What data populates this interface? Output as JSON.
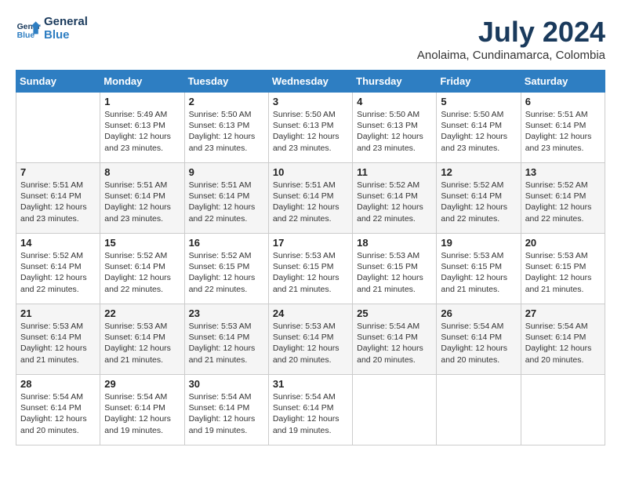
{
  "logo": {
    "line1": "General",
    "line2": "Blue"
  },
  "title": "July 2024",
  "location": "Anolaima, Cundinamarca, Colombia",
  "days_header": [
    "Sunday",
    "Monday",
    "Tuesday",
    "Wednesday",
    "Thursday",
    "Friday",
    "Saturday"
  ],
  "weeks": [
    [
      {
        "day": "",
        "info": ""
      },
      {
        "day": "1",
        "info": "Sunrise: 5:49 AM\nSunset: 6:13 PM\nDaylight: 12 hours\nand 23 minutes."
      },
      {
        "day": "2",
        "info": "Sunrise: 5:50 AM\nSunset: 6:13 PM\nDaylight: 12 hours\nand 23 minutes."
      },
      {
        "day": "3",
        "info": "Sunrise: 5:50 AM\nSunset: 6:13 PM\nDaylight: 12 hours\nand 23 minutes."
      },
      {
        "day": "4",
        "info": "Sunrise: 5:50 AM\nSunset: 6:13 PM\nDaylight: 12 hours\nand 23 minutes."
      },
      {
        "day": "5",
        "info": "Sunrise: 5:50 AM\nSunset: 6:14 PM\nDaylight: 12 hours\nand 23 minutes."
      },
      {
        "day": "6",
        "info": "Sunrise: 5:51 AM\nSunset: 6:14 PM\nDaylight: 12 hours\nand 23 minutes."
      }
    ],
    [
      {
        "day": "7",
        "info": "Sunrise: 5:51 AM\nSunset: 6:14 PM\nDaylight: 12 hours\nand 23 minutes."
      },
      {
        "day": "8",
        "info": "Sunrise: 5:51 AM\nSunset: 6:14 PM\nDaylight: 12 hours\nand 23 minutes."
      },
      {
        "day": "9",
        "info": "Sunrise: 5:51 AM\nSunset: 6:14 PM\nDaylight: 12 hours\nand 22 minutes."
      },
      {
        "day": "10",
        "info": "Sunrise: 5:51 AM\nSunset: 6:14 PM\nDaylight: 12 hours\nand 22 minutes."
      },
      {
        "day": "11",
        "info": "Sunrise: 5:52 AM\nSunset: 6:14 PM\nDaylight: 12 hours\nand 22 minutes."
      },
      {
        "day": "12",
        "info": "Sunrise: 5:52 AM\nSunset: 6:14 PM\nDaylight: 12 hours\nand 22 minutes."
      },
      {
        "day": "13",
        "info": "Sunrise: 5:52 AM\nSunset: 6:14 PM\nDaylight: 12 hours\nand 22 minutes."
      }
    ],
    [
      {
        "day": "14",
        "info": "Sunrise: 5:52 AM\nSunset: 6:14 PM\nDaylight: 12 hours\nand 22 minutes."
      },
      {
        "day": "15",
        "info": "Sunrise: 5:52 AM\nSunset: 6:14 PM\nDaylight: 12 hours\nand 22 minutes."
      },
      {
        "day": "16",
        "info": "Sunrise: 5:52 AM\nSunset: 6:15 PM\nDaylight: 12 hours\nand 22 minutes."
      },
      {
        "day": "17",
        "info": "Sunrise: 5:53 AM\nSunset: 6:15 PM\nDaylight: 12 hours\nand 21 minutes."
      },
      {
        "day": "18",
        "info": "Sunrise: 5:53 AM\nSunset: 6:15 PM\nDaylight: 12 hours\nand 21 minutes."
      },
      {
        "day": "19",
        "info": "Sunrise: 5:53 AM\nSunset: 6:15 PM\nDaylight: 12 hours\nand 21 minutes."
      },
      {
        "day": "20",
        "info": "Sunrise: 5:53 AM\nSunset: 6:15 PM\nDaylight: 12 hours\nand 21 minutes."
      }
    ],
    [
      {
        "day": "21",
        "info": "Sunrise: 5:53 AM\nSunset: 6:14 PM\nDaylight: 12 hours\nand 21 minutes."
      },
      {
        "day": "22",
        "info": "Sunrise: 5:53 AM\nSunset: 6:14 PM\nDaylight: 12 hours\nand 21 minutes."
      },
      {
        "day": "23",
        "info": "Sunrise: 5:53 AM\nSunset: 6:14 PM\nDaylight: 12 hours\nand 21 minutes."
      },
      {
        "day": "24",
        "info": "Sunrise: 5:53 AM\nSunset: 6:14 PM\nDaylight: 12 hours\nand 20 minutes."
      },
      {
        "day": "25",
        "info": "Sunrise: 5:54 AM\nSunset: 6:14 PM\nDaylight: 12 hours\nand 20 minutes."
      },
      {
        "day": "26",
        "info": "Sunrise: 5:54 AM\nSunset: 6:14 PM\nDaylight: 12 hours\nand 20 minutes."
      },
      {
        "day": "27",
        "info": "Sunrise: 5:54 AM\nSunset: 6:14 PM\nDaylight: 12 hours\nand 20 minutes."
      }
    ],
    [
      {
        "day": "28",
        "info": "Sunrise: 5:54 AM\nSunset: 6:14 PM\nDaylight: 12 hours\nand 20 minutes."
      },
      {
        "day": "29",
        "info": "Sunrise: 5:54 AM\nSunset: 6:14 PM\nDaylight: 12 hours\nand 19 minutes."
      },
      {
        "day": "30",
        "info": "Sunrise: 5:54 AM\nSunset: 6:14 PM\nDaylight: 12 hours\nand 19 minutes."
      },
      {
        "day": "31",
        "info": "Sunrise: 5:54 AM\nSunset: 6:14 PM\nDaylight: 12 hours\nand 19 minutes."
      },
      {
        "day": "",
        "info": ""
      },
      {
        "day": "",
        "info": ""
      },
      {
        "day": "",
        "info": ""
      }
    ]
  ]
}
